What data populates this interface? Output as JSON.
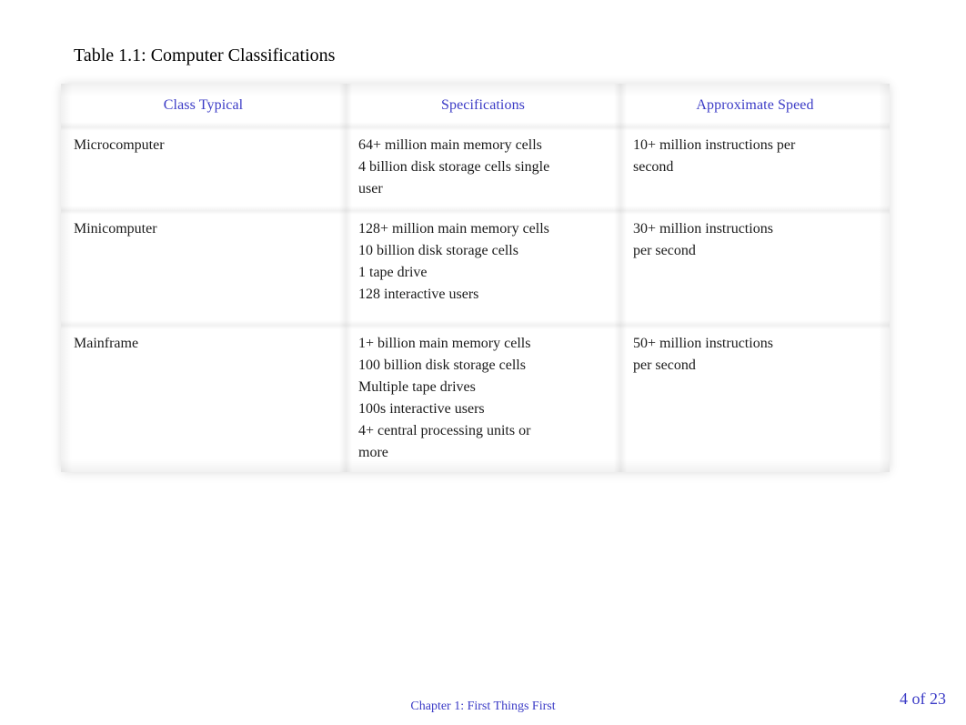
{
  "slide": {
    "title": "Table 1.1: Computer Classifications"
  },
  "table": {
    "columns": [
      "Class Typical",
      "Specifications",
      "Approximate Speed"
    ],
    "rows": [
      {
        "class_typical": [
          "Microcomputer"
        ],
        "specifications": [
          "64+ million main memory cells",
          "4 billion disk storage cells single",
          "user"
        ],
        "approximate_speed": [
          "10+ million instructions per",
          "second"
        ]
      },
      {
        "class_typical": [
          "Minicomputer"
        ],
        "specifications": [
          "128+ million main memory cells",
          "10 billion disk storage cells",
          "1 tape drive",
          "128 interactive users"
        ],
        "approximate_speed": [
          "30+ million instructions",
          "per second"
        ]
      },
      {
        "class_typical": [
          "Mainframe"
        ],
        "specifications": [
          "1+ billion main memory cells",
          "100 billion disk storage cells",
          "Multiple tape drives",
          "100s interactive users",
          "4+ central processing units or",
          "more"
        ],
        "approximate_speed": [
          "50+ million instructions",
          "per second"
        ]
      }
    ]
  },
  "footer": {
    "chapter": "Chapter 1: First Things First",
    "page": "4 of 23"
  },
  "colors": {
    "accent_blue": "#3b3bc6",
    "text_black": "#1a1a1a",
    "page_background": "#ffffff"
  }
}
